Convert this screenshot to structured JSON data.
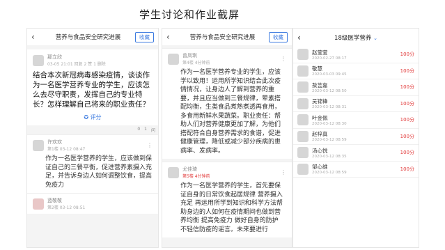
{
  "slide_title": "学生讨论和作业截屏",
  "panel1": {
    "nav_title": "营养与食品安全研究进展",
    "fav_label": "收藏",
    "post": {
      "user": "那立欣",
      "meta": "03-05 21:01  回复 2  赞 1  删除",
      "text": "结合本次新冠病毒感染疫情，谈谈作为一名医学营养专业的学生，应该怎么去尽守职责，发挥自己的专业特长？怎样理解自己将来的职业责任？",
      "rate_label": "评分"
    },
    "stats": [
      "0",
      "1",
      "问"
    ],
    "replies": [
      {
        "user": "许欢欢",
        "meta": "第1楼  03-12 08:47",
        "text": "作为一名医学营养的学生，应该做到保证自己的三餐平衡，促进营养素摄入充足，并告诉身边人如何调整饮食，提高免疫力"
      },
      {
        "user": "蓝敬敬",
        "meta": "第2楼  03-12 08:51",
        "text": ""
      }
    ]
  },
  "panel2": {
    "nav_title": "营养与食品安全研究进展",
    "fav_label": "收藏",
    "replies": [
      {
        "user": "曾凤琪",
        "meta": "第4楼  4分钟前",
        "text": "作为一名医学营养专业的学生，应该学以致用！运用所学知识结合此次疫情情况，让身边人了解到营养的重要，并且应当做到三餐规律，荤素搭配均衡，生类食品煮熟煮透再食用，多食用新鲜水果蔬菜。职业责任：帮助人们对营养健康更加了解，为他们搭配符合自身营养需求的食谱，促进健康管理，降低或减少部分疾病的患病率、发病率。"
      },
      {
        "user": "尤佳琦",
        "meta": "第5楼  4分钟前",
        "text": "作为一名医学营养的学生，首先要保证自身的日常饮食起居规律 营养摄入充足 再运用所学到知识和科学方法帮助身边的人如何在疫情期间也做到营养均衡 提高免疫力 做好自身的防护 不轻信防疫的谣言。未来要进行"
      }
    ]
  },
  "panel3": {
    "title": "18级医学营养",
    "caret": "⌄",
    "students": [
      {
        "name": "赵莹莹",
        "date": "2020-02-27 08:17",
        "score": "100分"
      },
      {
        "name": "敬慧",
        "date": "2020-03-03 09:45",
        "score": "100分"
      },
      {
        "name": "敖芸嘉",
        "date": "2020-03-12 08:50",
        "score": "100分"
      },
      {
        "name": "吴锦锋",
        "date": "2020-03-12 08:31",
        "score": "100分"
      },
      {
        "name": "叶金佩",
        "date": "2020-03-12 08:30",
        "score": "100分"
      },
      {
        "name": "赵梓真",
        "date": "2020-03-12 08:59",
        "score": "100分"
      },
      {
        "name": "汤心悦",
        "date": "2020-03-12 08:35",
        "score": "100分"
      },
      {
        "name": "邹心维",
        "date": "2020-03-12 08:59",
        "score": "100分"
      }
    ]
  },
  "colors": {
    "accent": "#3d7be0",
    "score": "#e23c3c"
  }
}
